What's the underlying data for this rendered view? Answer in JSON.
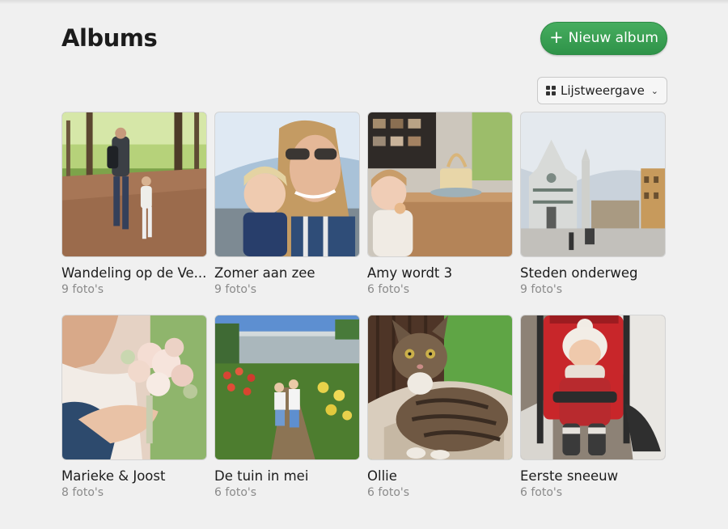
{
  "header": {
    "title": "Albums",
    "new_album_icon": "plus-icon",
    "new_album_label": "Nieuw album"
  },
  "view_toggle": {
    "icon": "grid-icon",
    "label": "Lijstweergave",
    "chevron": "chevron-down-icon"
  },
  "colors": {
    "accent_green": "#3a9f53",
    "background": "#f0f0f0",
    "muted_text": "#8a8a8a"
  },
  "albums": [
    {
      "title": "Wandeling op de Ve...",
      "count": "9 foto's"
    },
    {
      "title": "Zomer aan zee",
      "count": "9 foto's"
    },
    {
      "title": "Amy wordt 3",
      "count": "6 foto's"
    },
    {
      "title": "Steden onderweg",
      "count": "9 foto's"
    },
    {
      "title": "Marieke & Joost",
      "count": "8 foto's"
    },
    {
      "title": "De tuin in mei",
      "count": "6 foto's"
    },
    {
      "title": "Ollie",
      "count": "6 foto's"
    },
    {
      "title": "Eerste sneeuw",
      "count": "6 foto's"
    }
  ]
}
